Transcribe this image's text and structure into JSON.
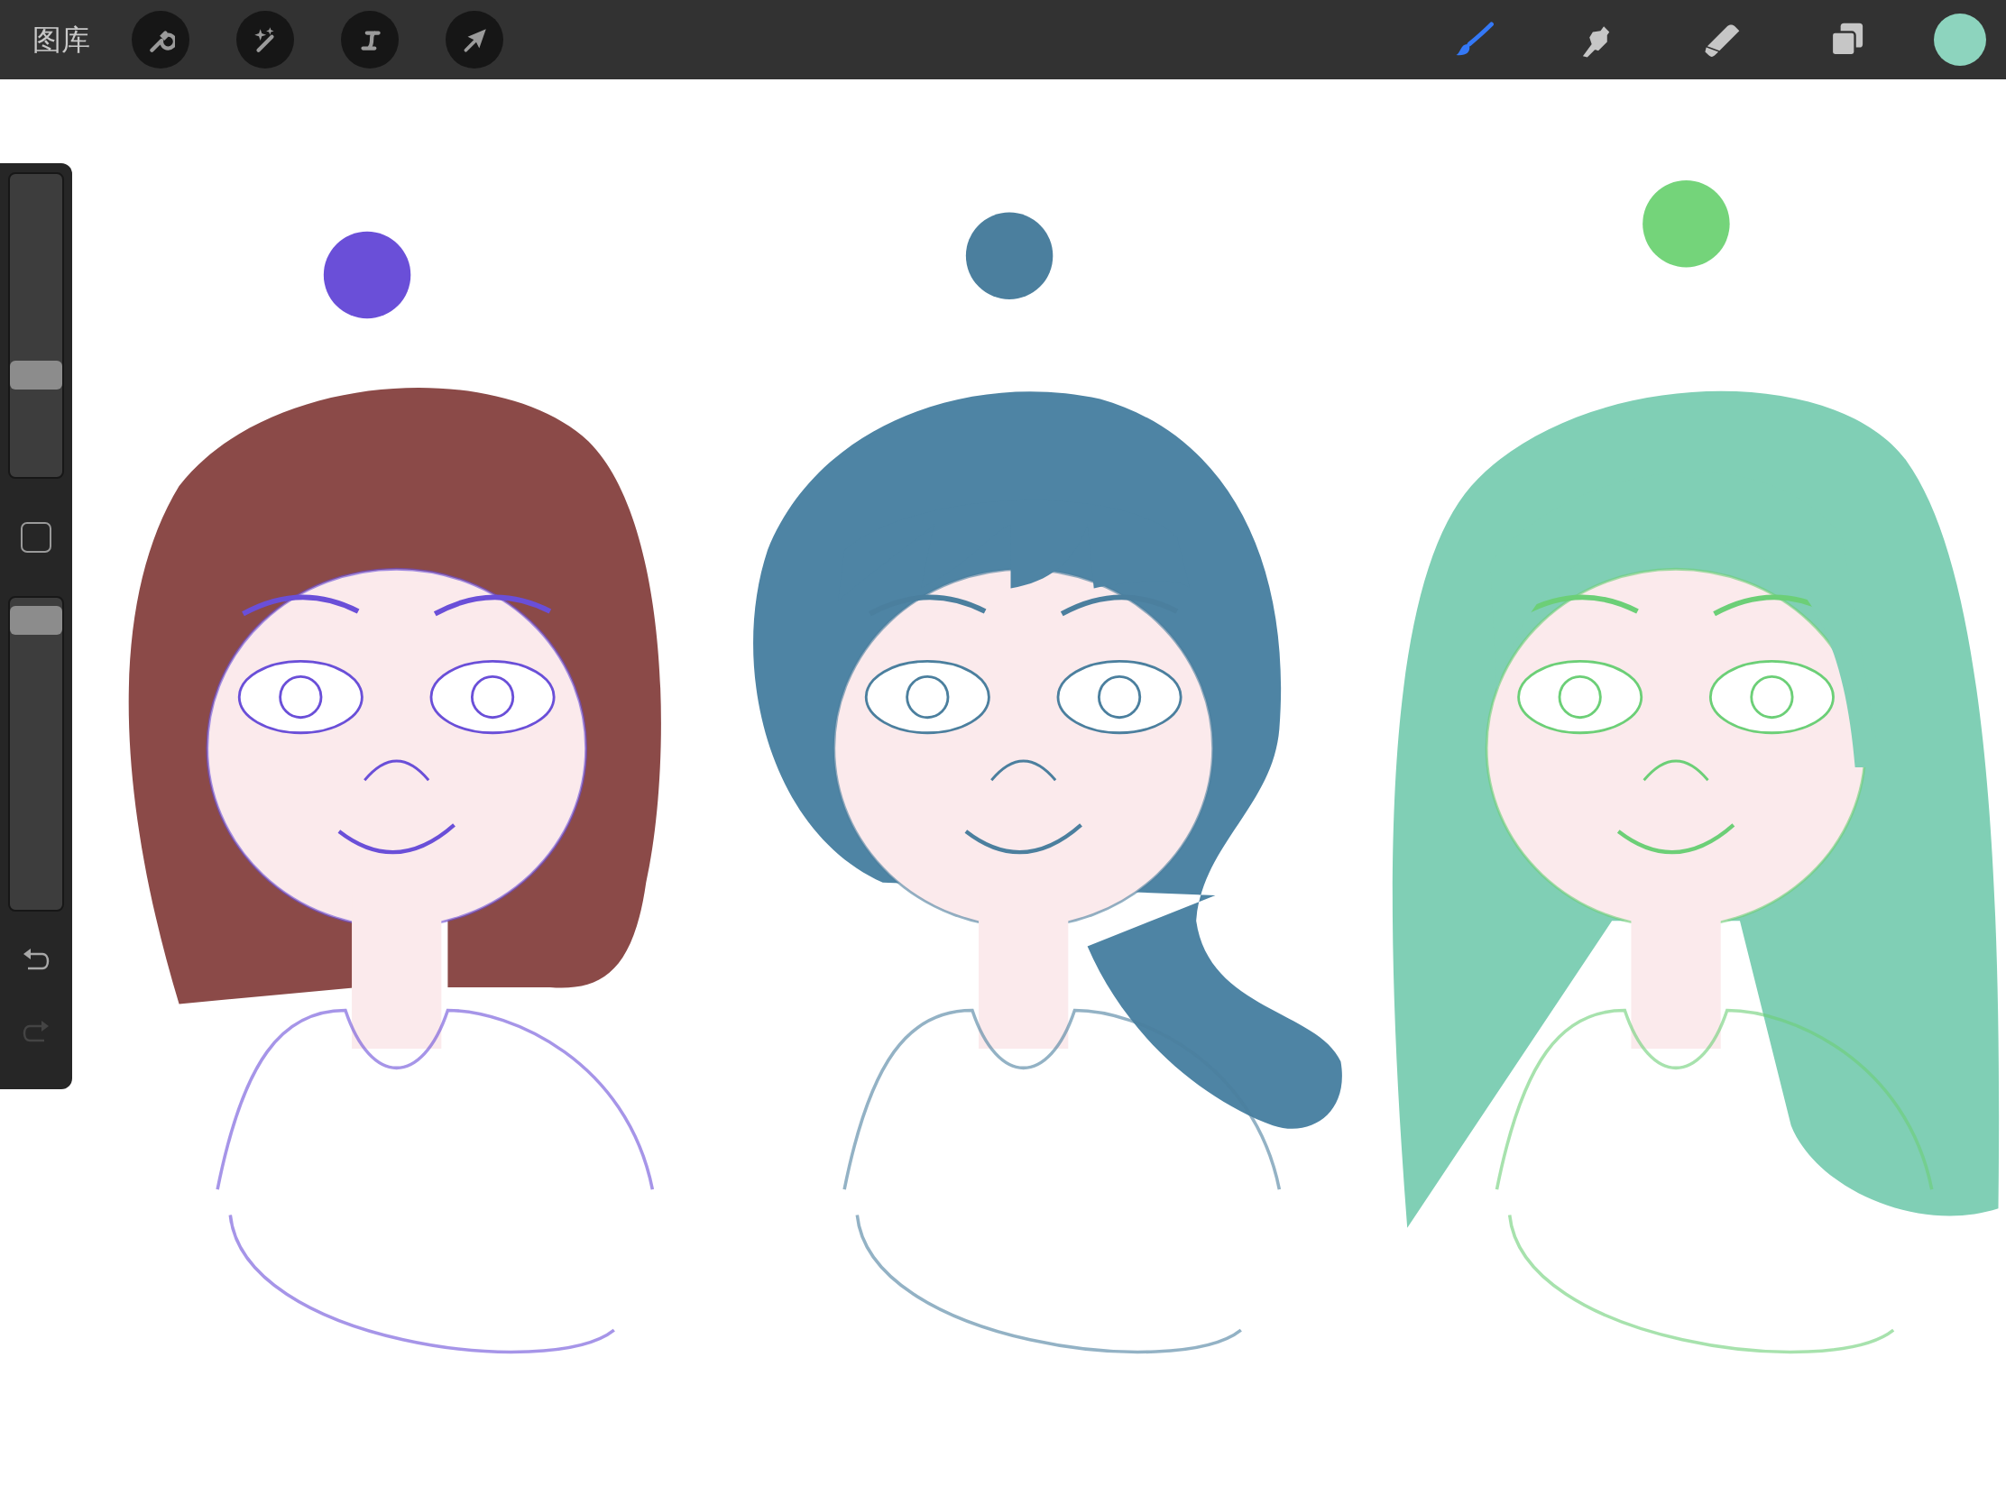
{
  "top_bar": {
    "gallery_label": "图库",
    "actions": [
      {
        "kind": "wrench"
      },
      {
        "kind": "magic"
      },
      {
        "kind": "selection"
      },
      {
        "kind": "transform"
      }
    ],
    "tools": [
      {
        "kind": "brush",
        "selected": true
      },
      {
        "kind": "smudge",
        "selected": false
      },
      {
        "kind": "eraser",
        "selected": false
      },
      {
        "kind": "layers",
        "selected": false
      }
    ],
    "current_color": {
      "color": "#8dd4be"
    }
  },
  "sidebar": {
    "brush_size": {
      "level": 0.32
    },
    "opacity": {
      "level": 0.97
    },
    "undo": {
      "disabled": false
    },
    "redo": {
      "disabled": true
    }
  }
}
